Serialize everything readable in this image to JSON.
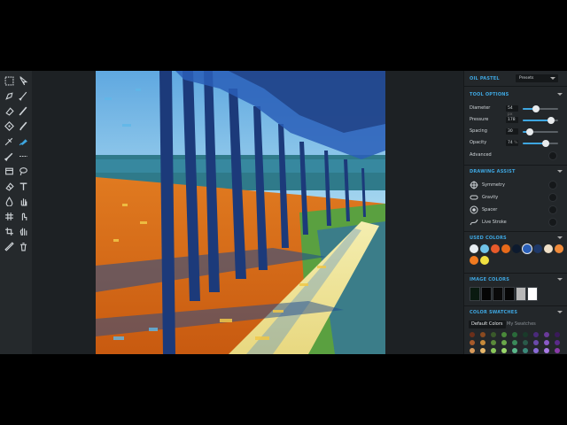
{
  "panel": {
    "oil_pastel": "OIL PASTEL",
    "presets": "Presets",
    "tool_options": "TOOL OPTIONS",
    "diameter_label": "Diameter",
    "diameter_value": "54",
    "diameter_unit": "px",
    "diameter_level": 0.38,
    "pressure_label": "Pressure",
    "pressure_value": "178",
    "pressure_level": 0.8,
    "spacing_label": "Spacing",
    "spacing_value": "30",
    "spacing_level": 0.2,
    "opacity_label": "Opacity",
    "opacity_value": "74",
    "opacity_unit": "%",
    "opacity_level": 0.65,
    "advanced_label": "Advanced",
    "drawing_assist": "DRAWING ASSIST",
    "assist": [
      "Symmetry",
      "Gravity",
      "Spacer",
      "Live Stroke"
    ],
    "used_colors": "USED COLORS",
    "used_color_values": [
      "#e8eef2",
      "#6fc3e8",
      "#e85a2a",
      "#e86a1a",
      "#0d1a2e",
      "#2a5fb8",
      "#1e3868",
      "#f0e0c8",
      "#f08a3a",
      "#f07a20",
      "#f0e040"
    ],
    "image_colors": "IMAGE COLORS",
    "image_color_values": [
      "#0a1a10",
      "#050505",
      "#0a0a0a",
      "#050505",
      "#b8b8b8",
      "#ffffff"
    ],
    "color_swatches": "COLOR SWATCHES",
    "default_colors": "Default Colors",
    "my_swatches": "My Swatches",
    "accent": "#3ea6e0"
  },
  "tools": [
    "marquee-icon",
    "select-arrow-icon",
    "pen-icon",
    "brush-icon",
    "eraser-icon",
    "pencil-icon",
    "shape-icon",
    "marker-icon",
    "airbrush-icon",
    "paint-bucket-brush-icon",
    "dropper-icon",
    "line-tool-icon",
    "layer-icon",
    "lasso-icon",
    "eraser-small-icon",
    "text-icon",
    "drop-icon",
    "hand-icon",
    "grid-icon",
    "smudge-icon",
    "crop-icon",
    "pan-icon",
    "eyedropper-icon",
    "trash-icon"
  ]
}
